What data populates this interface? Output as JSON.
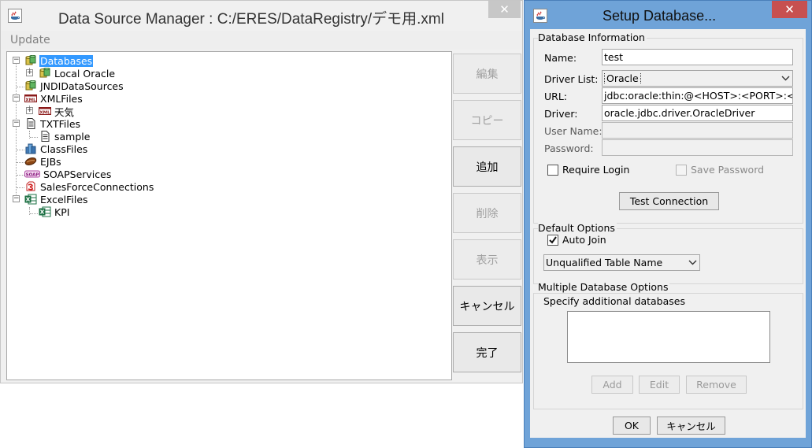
{
  "dsm": {
    "title": "Data Source Manager : C:/ERES/DataRegistry/デモ用.xml",
    "close_glyph": "✕",
    "menu": {
      "update": "Update"
    },
    "tree": {
      "databases": "Databases",
      "local_oracle": "Local Oracle",
      "jndi": "JNDIDataSources",
      "xmlfiles": "XMLFiles",
      "tenki": "天気",
      "txtfiles": "TXTFiles",
      "sample": "sample",
      "classfiles": "ClassFiles",
      "ejbs": "EJBs",
      "soap": "SOAPServices",
      "salesforce": "SalesForceConnections",
      "excelfiles": "ExcelFiles",
      "kpi": "KPI"
    },
    "icon_text": {
      "xml": "XML",
      "soap": "SOAP"
    },
    "buttons": {
      "edit": "編集",
      "copy": "コピー",
      "add": "追加",
      "delete": "削除",
      "view": "表示",
      "cancel": "キャンセル",
      "done": "完了"
    }
  },
  "setup": {
    "title": "Setup Database...",
    "close_glyph": "✕",
    "db_info": {
      "legend": "Database Information",
      "name_label": "Name:",
      "name_value": "test",
      "driver_list_label": "Driver List:",
      "driver_list_value": "Oracle",
      "url_label": "URL:",
      "url_value": "jdbc:oracle:thin:@<HOST>:<PORT>:<SID>",
      "driver_label": "Driver:",
      "driver_value": "oracle.jdbc.driver.OracleDriver",
      "username_label": "User Name:",
      "username_value": "",
      "password_label": "Password:",
      "password_value": "",
      "require_login": "Require Login",
      "require_login_checked": false,
      "save_password": "Save Password",
      "save_password_checked": false,
      "test_connection": "Test Connection"
    },
    "default_options": {
      "legend": "Default Options",
      "auto_join": "Auto Join",
      "auto_join_checked": true,
      "table_name_mode": "Unqualified Table Name"
    },
    "multi_db": {
      "legend": "Multiple Database Options",
      "specify_label": "Specify additional databases",
      "add": "Add",
      "edit": "Edit",
      "remove": "Remove"
    },
    "ok": "OK",
    "cancel": "キャンセル"
  }
}
